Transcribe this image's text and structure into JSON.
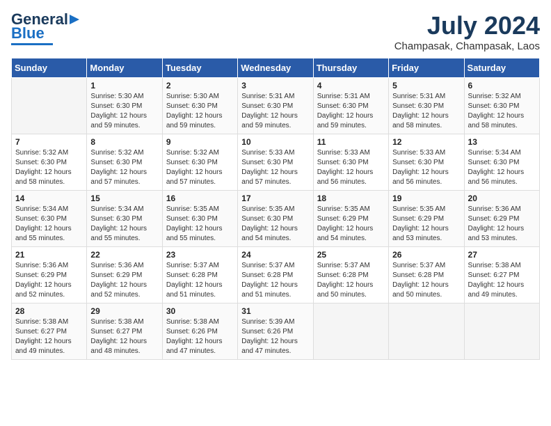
{
  "header": {
    "logo_line1": "General",
    "logo_line2": "Blue",
    "month": "July 2024",
    "location": "Champasak, Champasak, Laos"
  },
  "weekdays": [
    "Sunday",
    "Monday",
    "Tuesday",
    "Wednesday",
    "Thursday",
    "Friday",
    "Saturday"
  ],
  "weeks": [
    [
      {
        "day": "",
        "info": ""
      },
      {
        "day": "1",
        "info": "Sunrise: 5:30 AM\nSunset: 6:30 PM\nDaylight: 12 hours\nand 59 minutes."
      },
      {
        "day": "2",
        "info": "Sunrise: 5:30 AM\nSunset: 6:30 PM\nDaylight: 12 hours\nand 59 minutes."
      },
      {
        "day": "3",
        "info": "Sunrise: 5:31 AM\nSunset: 6:30 PM\nDaylight: 12 hours\nand 59 minutes."
      },
      {
        "day": "4",
        "info": "Sunrise: 5:31 AM\nSunset: 6:30 PM\nDaylight: 12 hours\nand 59 minutes."
      },
      {
        "day": "5",
        "info": "Sunrise: 5:31 AM\nSunset: 6:30 PM\nDaylight: 12 hours\nand 58 minutes."
      },
      {
        "day": "6",
        "info": "Sunrise: 5:32 AM\nSunset: 6:30 PM\nDaylight: 12 hours\nand 58 minutes."
      }
    ],
    [
      {
        "day": "7",
        "info": "Sunrise: 5:32 AM\nSunset: 6:30 PM\nDaylight: 12 hours\nand 58 minutes."
      },
      {
        "day": "8",
        "info": "Sunrise: 5:32 AM\nSunset: 6:30 PM\nDaylight: 12 hours\nand 57 minutes."
      },
      {
        "day": "9",
        "info": "Sunrise: 5:32 AM\nSunset: 6:30 PM\nDaylight: 12 hours\nand 57 minutes."
      },
      {
        "day": "10",
        "info": "Sunrise: 5:33 AM\nSunset: 6:30 PM\nDaylight: 12 hours\nand 57 minutes."
      },
      {
        "day": "11",
        "info": "Sunrise: 5:33 AM\nSunset: 6:30 PM\nDaylight: 12 hours\nand 56 minutes."
      },
      {
        "day": "12",
        "info": "Sunrise: 5:33 AM\nSunset: 6:30 PM\nDaylight: 12 hours\nand 56 minutes."
      },
      {
        "day": "13",
        "info": "Sunrise: 5:34 AM\nSunset: 6:30 PM\nDaylight: 12 hours\nand 56 minutes."
      }
    ],
    [
      {
        "day": "14",
        "info": "Sunrise: 5:34 AM\nSunset: 6:30 PM\nDaylight: 12 hours\nand 55 minutes."
      },
      {
        "day": "15",
        "info": "Sunrise: 5:34 AM\nSunset: 6:30 PM\nDaylight: 12 hours\nand 55 minutes."
      },
      {
        "day": "16",
        "info": "Sunrise: 5:35 AM\nSunset: 6:30 PM\nDaylight: 12 hours\nand 55 minutes."
      },
      {
        "day": "17",
        "info": "Sunrise: 5:35 AM\nSunset: 6:30 PM\nDaylight: 12 hours\nand 54 minutes."
      },
      {
        "day": "18",
        "info": "Sunrise: 5:35 AM\nSunset: 6:29 PM\nDaylight: 12 hours\nand 54 minutes."
      },
      {
        "day": "19",
        "info": "Sunrise: 5:35 AM\nSunset: 6:29 PM\nDaylight: 12 hours\nand 53 minutes."
      },
      {
        "day": "20",
        "info": "Sunrise: 5:36 AM\nSunset: 6:29 PM\nDaylight: 12 hours\nand 53 minutes."
      }
    ],
    [
      {
        "day": "21",
        "info": "Sunrise: 5:36 AM\nSunset: 6:29 PM\nDaylight: 12 hours\nand 52 minutes."
      },
      {
        "day": "22",
        "info": "Sunrise: 5:36 AM\nSunset: 6:29 PM\nDaylight: 12 hours\nand 52 minutes."
      },
      {
        "day": "23",
        "info": "Sunrise: 5:37 AM\nSunset: 6:28 PM\nDaylight: 12 hours\nand 51 minutes."
      },
      {
        "day": "24",
        "info": "Sunrise: 5:37 AM\nSunset: 6:28 PM\nDaylight: 12 hours\nand 51 minutes."
      },
      {
        "day": "25",
        "info": "Sunrise: 5:37 AM\nSunset: 6:28 PM\nDaylight: 12 hours\nand 50 minutes."
      },
      {
        "day": "26",
        "info": "Sunrise: 5:37 AM\nSunset: 6:28 PM\nDaylight: 12 hours\nand 50 minutes."
      },
      {
        "day": "27",
        "info": "Sunrise: 5:38 AM\nSunset: 6:27 PM\nDaylight: 12 hours\nand 49 minutes."
      }
    ],
    [
      {
        "day": "28",
        "info": "Sunrise: 5:38 AM\nSunset: 6:27 PM\nDaylight: 12 hours\nand 49 minutes."
      },
      {
        "day": "29",
        "info": "Sunrise: 5:38 AM\nSunset: 6:27 PM\nDaylight: 12 hours\nand 48 minutes."
      },
      {
        "day": "30",
        "info": "Sunrise: 5:38 AM\nSunset: 6:26 PM\nDaylight: 12 hours\nand 47 minutes."
      },
      {
        "day": "31",
        "info": "Sunrise: 5:39 AM\nSunset: 6:26 PM\nDaylight: 12 hours\nand 47 minutes."
      },
      {
        "day": "",
        "info": ""
      },
      {
        "day": "",
        "info": ""
      },
      {
        "day": "",
        "info": ""
      }
    ]
  ]
}
